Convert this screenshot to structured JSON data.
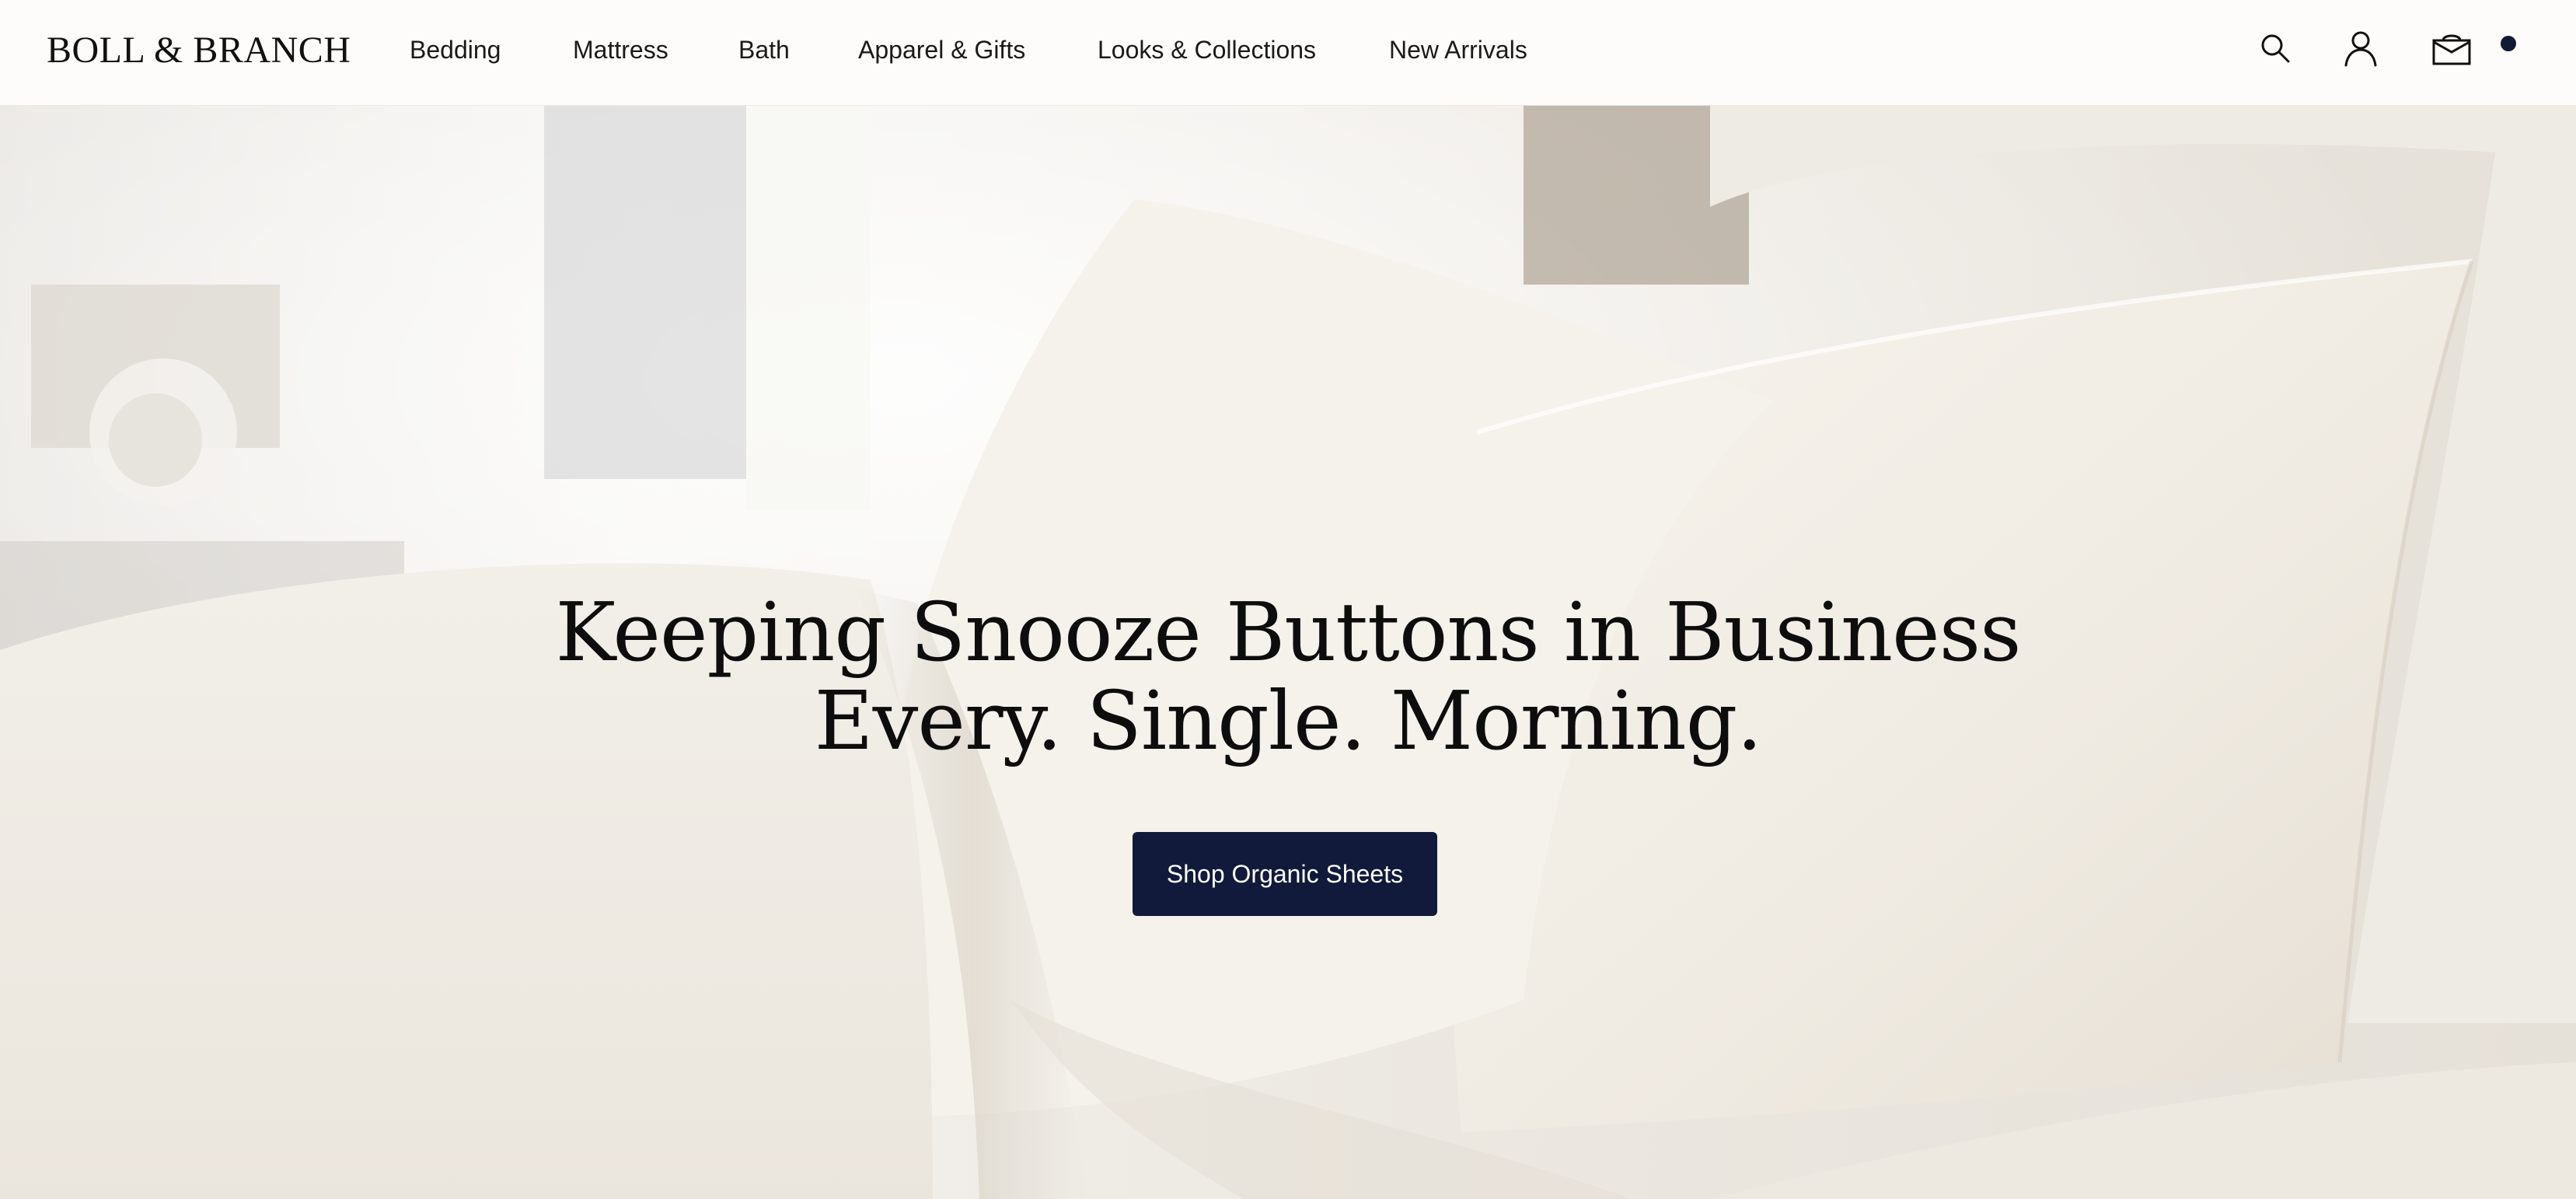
{
  "header": {
    "logo": "BOLL & BRANCH",
    "nav": [
      {
        "label": "Bedding"
      },
      {
        "label": "Mattress"
      },
      {
        "label": "Bath"
      },
      {
        "label": "Apparel & Gifts"
      },
      {
        "label": "Looks & Collections"
      },
      {
        "label": "New Arrivals"
      }
    ],
    "icons": {
      "search": "search-icon",
      "account": "account-icon",
      "cart": "cart-icon",
      "cart_indicator": "cart-dot"
    }
  },
  "hero": {
    "headline_line1": "Keeping Snooze Buttons in Business",
    "headline_line2": "Every. Single. Morning.",
    "cta_label": "Shop Organic Sheets",
    "image_subject": "white pillows and duvet on a bed"
  },
  "colors": {
    "header_bg": "#fdfcfa",
    "text": "#111111",
    "cta_bg": "#111a3a",
    "cta_text": "#ffffff",
    "cart_dot": "#111a35"
  }
}
